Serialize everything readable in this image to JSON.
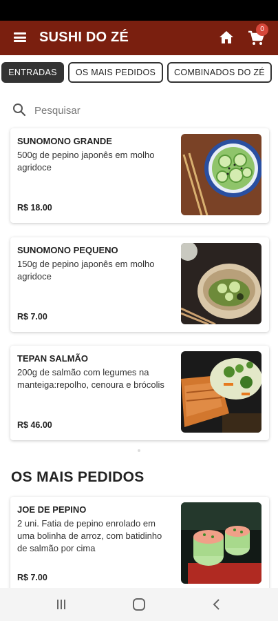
{
  "app": {
    "title": "SUSHI DO ZÉ",
    "cart_count": "0",
    "brand_color": "#7a1f0f"
  },
  "tabs": [
    {
      "label": "ENTRADAS",
      "active": true
    },
    {
      "label": "OS MAIS PEDIDOS",
      "active": false
    },
    {
      "label": "COMBINADOS DO ZÉ",
      "active": false
    }
  ],
  "search": {
    "placeholder": "Pesquisar"
  },
  "entradas": [
    {
      "name": "SUNOMONO GRANDE",
      "description": "500g de pepino japonês em molho agridoce",
      "price": "R$ 18.00",
      "image": "cucumber-salad-bowl"
    },
    {
      "name": "SUNOMONO PEQUENO",
      "description": "150g de pepino japonês em molho agridoce",
      "price": "R$ 7.00",
      "image": "cucumber-salad-small-bowl"
    },
    {
      "name": "TEPAN SALMÃO",
      "description": "200g de salmão com legumes na manteiga:repolho, cenoura e brócolis",
      "price": "R$ 46.00",
      "image": "grilled-salmon-vegetables"
    }
  ],
  "mais_pedidos": {
    "title": "OS MAIS PEDIDOS",
    "items": [
      {
        "name": "JOE DE PEPINO",
        "description": "2 uni. Fatia de pepino enrolado em uma bolinha de arroz, com batidinho de salmão por cima",
        "price": "R$ 7.00",
        "image": "cucumber-salmon-joe"
      }
    ]
  },
  "navbar": {
    "icons": [
      "recent-apps-icon",
      "home-circle-icon",
      "back-icon"
    ]
  }
}
